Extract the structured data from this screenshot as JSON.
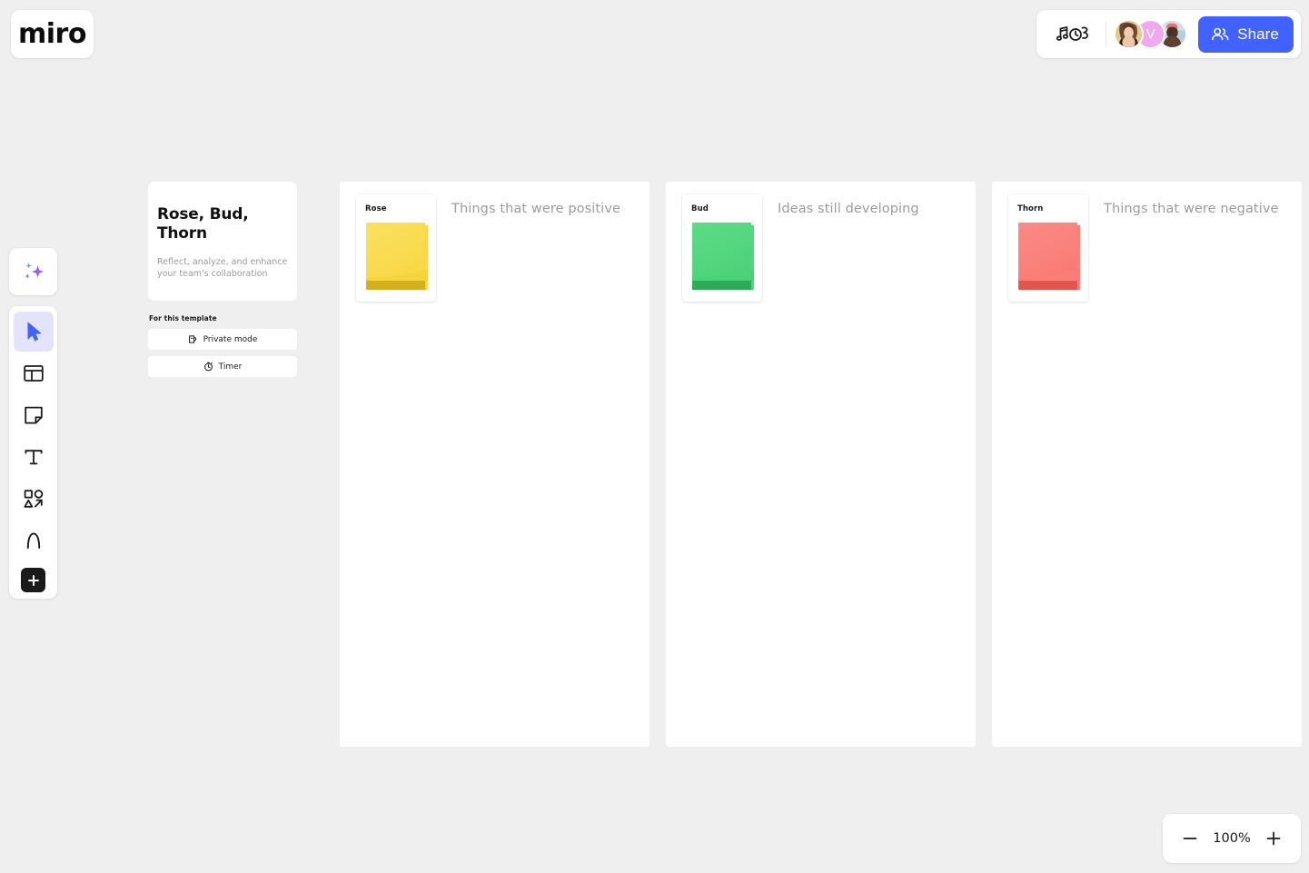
{
  "app": {
    "name": "miro",
    "logo_text": "miro"
  },
  "header": {
    "reactions_icon": "music-notes-reactions-icon",
    "collaborators": [
      {
        "name": "collaborator-1",
        "type": "photo",
        "bg": "#d9b77c",
        "initial": ""
      },
      {
        "name": "collaborator-2",
        "type": "initial",
        "bg": "#f0a8ef",
        "initial": "V"
      },
      {
        "name": "collaborator-3",
        "type": "photo",
        "bg": "#8a9fae",
        "initial": ""
      }
    ],
    "share": {
      "label": "Share",
      "icon": "people-icon",
      "color": "#4262ff"
    }
  },
  "toolbar": {
    "ai_tool": {
      "name": "ai-sparkle-tool",
      "icon": "sparkles-icon",
      "color": "#8b5cf6",
      "accent": "#60a5fa"
    },
    "tools": [
      {
        "name": "select-tool",
        "icon": "cursor-icon",
        "active": true
      },
      {
        "name": "templates-tool",
        "icon": "template-icon",
        "active": false
      },
      {
        "name": "sticky-note-tool",
        "icon": "sticky-note-icon",
        "active": false
      },
      {
        "name": "text-tool",
        "icon": "text-icon",
        "active": false
      },
      {
        "name": "shapes-tool",
        "icon": "shapes-icon",
        "active": false
      },
      {
        "name": "pen-tool",
        "icon": "pen-curve-icon",
        "active": false
      },
      {
        "name": "more-apps-tool",
        "icon": "plus-icon",
        "active": false
      }
    ],
    "active_tool_bg": "#e3e4fc",
    "active_tool_color": "#4262ff"
  },
  "template_panel": {
    "title": "Rose, Bud, Thorn",
    "subtitle": "Reflect, analyze, and enhance your team's collaboration",
    "tools_heading": "For this template",
    "tools": [
      {
        "label": "Private mode",
        "icon": "private-mode-icon"
      },
      {
        "label": "Timer",
        "icon": "timer-icon"
      }
    ]
  },
  "board": {
    "columns": [
      {
        "name": "rose",
        "sticky_label": "Rose",
        "caption": "Things that were positive",
        "note_color": "#fbdf5e",
        "note_color_dark": "#f5d43e",
        "note_strip": "#d4b01f",
        "note_back": "#f8d94d"
      },
      {
        "name": "bud",
        "sticky_label": "Bud",
        "caption": "Ideas still developing",
        "note_color": "#5ddb86",
        "note_color_dark": "#4bd177",
        "note_strip": "#2eab58",
        "note_back": "#52d67e"
      },
      {
        "name": "thorn",
        "sticky_label": "Thorn",
        "caption": "Things that were negative",
        "note_color": "#fb8a86",
        "note_color_dark": "#fa7d78",
        "note_strip": "#e45550",
        "note_back": "#fa807b"
      }
    ]
  },
  "zoom_control": {
    "zoom_out_label": "zoom-out",
    "zoom_in_label": "zoom-in",
    "level": "100%"
  }
}
